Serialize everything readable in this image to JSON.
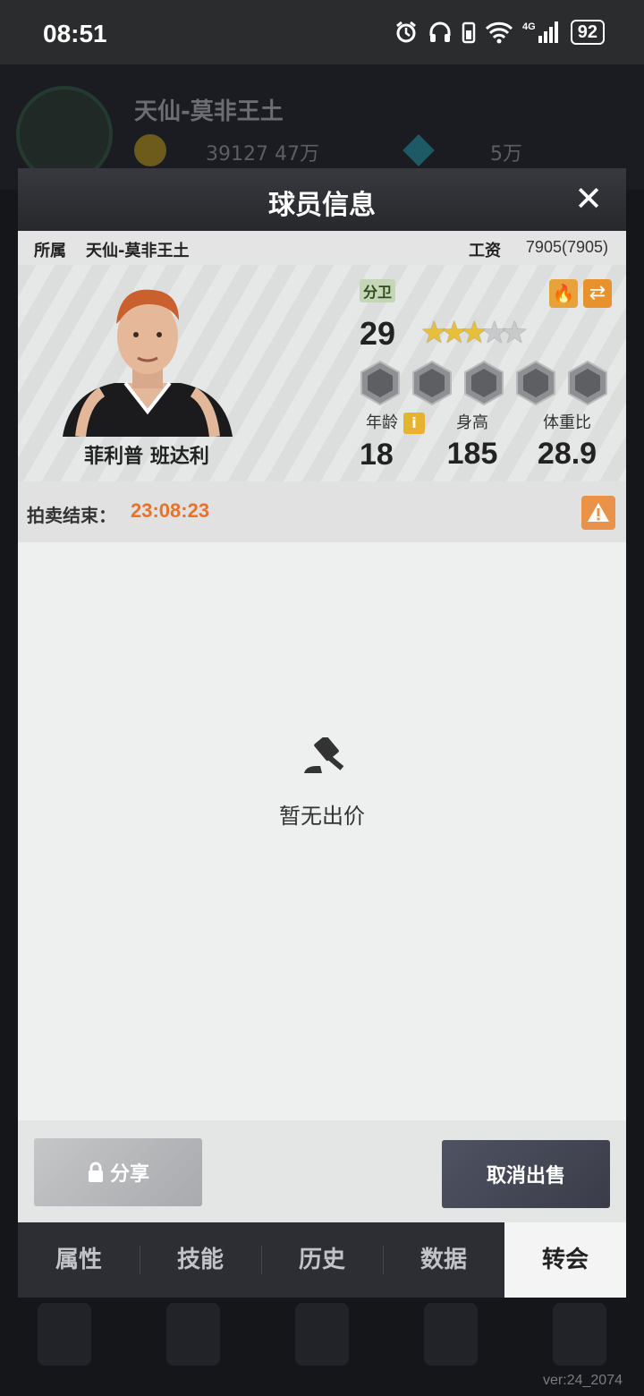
{
  "status_bar": {
    "time": "08:51",
    "battery": "92",
    "network": "4G"
  },
  "background": {
    "team_name": "天仙-莫非王土",
    "coins": "39127 47万",
    "gems": "5万",
    "version": "ver:24_2074"
  },
  "modal": {
    "title": "球员信息",
    "affiliation_label": "所属",
    "affiliation_team": "天仙-莫非王土",
    "salary_label": "工资",
    "salary_value": "7905(7905)",
    "player": {
      "name": "菲利普 班达利",
      "position": "分卫",
      "rating": "29",
      "stars_filled": 3,
      "stars_total": 5,
      "stats": [
        {
          "label": "年龄",
          "value": "18"
        },
        {
          "label": "身高",
          "value": "185"
        },
        {
          "label": "体重比",
          "value": "28.9"
        }
      ]
    },
    "auction_label": "拍卖结束：",
    "auction_time": "23:08:23",
    "empty_message": "暂无出价",
    "share_label": "分享",
    "cancel_sale_label": "取消出售",
    "tabs": [
      "属性",
      "技能",
      "历史",
      "数据",
      "转会"
    ],
    "active_tab": "转会"
  },
  "colors": {
    "accent_orange": "#e8722a",
    "star_gold": "#e7bf3a",
    "header_dark": "#2d2e34"
  }
}
